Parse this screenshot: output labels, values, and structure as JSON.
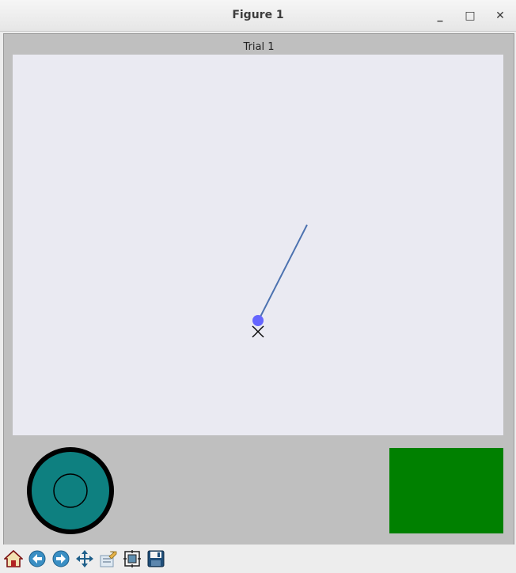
{
  "window": {
    "title": "Figure 1",
    "minimize_glyph": "_",
    "maximize_glyph": "□",
    "close_glyph": "✕"
  },
  "figure": {
    "axes_title": "Trial 1",
    "background_color": "#bfbfbf",
    "axes_color": "#eaeaf2",
    "trajectory_color": "#4c72b0",
    "cursor_color": "#6666ff",
    "target_marker": "x",
    "joystick_fill": "#0e8080",
    "status_color": "#008000"
  },
  "toolbar": {
    "buttons": [
      {
        "name": "home",
        "icon": "home-icon"
      },
      {
        "name": "back",
        "icon": "back-arrow-icon"
      },
      {
        "name": "forward",
        "icon": "forward-arrow-icon"
      },
      {
        "name": "pan",
        "icon": "pan-move-icon"
      },
      {
        "name": "zoom",
        "icon": "zoom-rect-icon"
      },
      {
        "name": "configure",
        "icon": "configure-subplots-icon"
      },
      {
        "name": "save",
        "icon": "save-floppy-icon"
      }
    ]
  }
}
